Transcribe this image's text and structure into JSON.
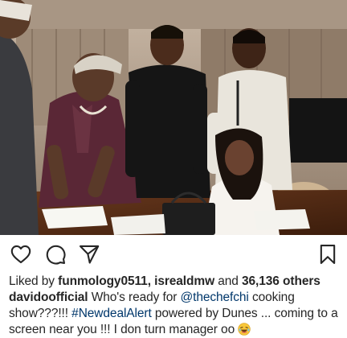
{
  "post": {
    "image": {
      "description_icon": "photo-icon"
    },
    "actions": {
      "like_icon": "heart-icon",
      "comment_icon": "comment-icon",
      "share_icon": "share-icon",
      "save_icon": "bookmark-icon"
    },
    "likes": {
      "prefix": "Liked by ",
      "user1": "funmology0511",
      "separator": ", ",
      "user2": "isrealdmw",
      "middle": " and ",
      "count": "36,136 others"
    },
    "caption": {
      "username": "davidoofficial",
      "text1": " Who's ready for ",
      "mention": "@thechefchi",
      "text2": " cooking show???!!! ",
      "hashtag": "#NewdealAlert",
      "text3": " powered by Dunes ... coming to a screen near you !!! I don turn manager oo ",
      "emoji_icon": "laughing-emoji-icon"
    },
    "colors": {
      "text": "#262626",
      "link": "#00376b"
    }
  }
}
